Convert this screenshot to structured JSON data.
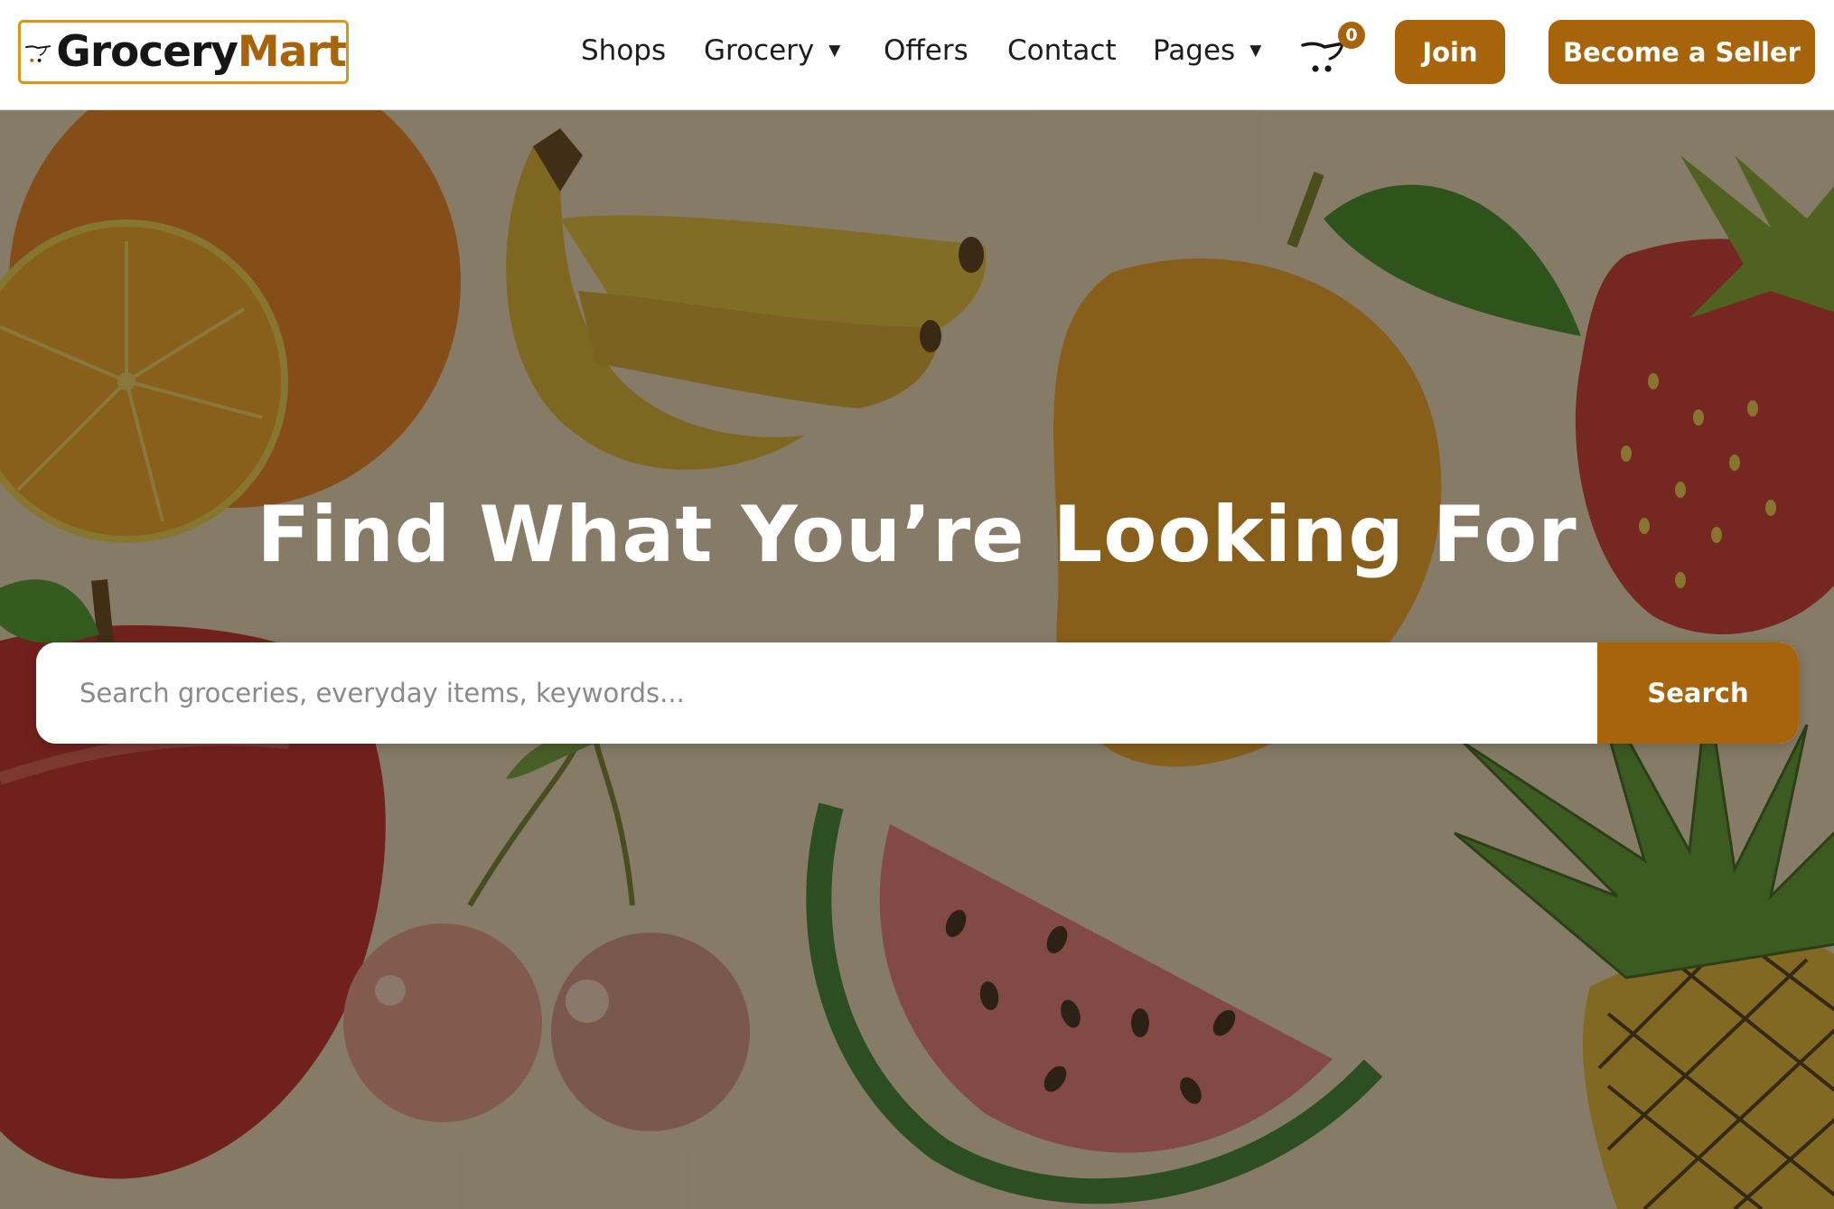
{
  "brand": {
    "part1": "Grocery",
    "part2": "Mart",
    "logo_icon": "shopping-cart-icon"
  },
  "nav": {
    "items": [
      {
        "label": "Shops",
        "dropdown": false
      },
      {
        "label": "Grocery",
        "dropdown": true
      },
      {
        "label": "Offers",
        "dropdown": false
      },
      {
        "label": "Contact",
        "dropdown": false
      },
      {
        "label": "Pages",
        "dropdown": true
      }
    ],
    "dropdown_glyph": "▼"
  },
  "cart": {
    "icon": "shopping-cart-icon",
    "count": "0"
  },
  "buttons": {
    "join": "Join",
    "become_seller": "Become a Seller"
  },
  "hero": {
    "title": "Find What You’re Looking For",
    "background": "illustrated fruits: orange, banana, mango, strawberry, apple, cherries, watermelon, pineapple"
  },
  "search": {
    "placeholder": "Search groceries, everyday items, keywords...",
    "value": "",
    "button_label": "Search"
  },
  "colors": {
    "accent": "#a8640a",
    "logo_border": "#d8961c",
    "text_dark": "#1d1d1d",
    "white": "#ffffff"
  }
}
